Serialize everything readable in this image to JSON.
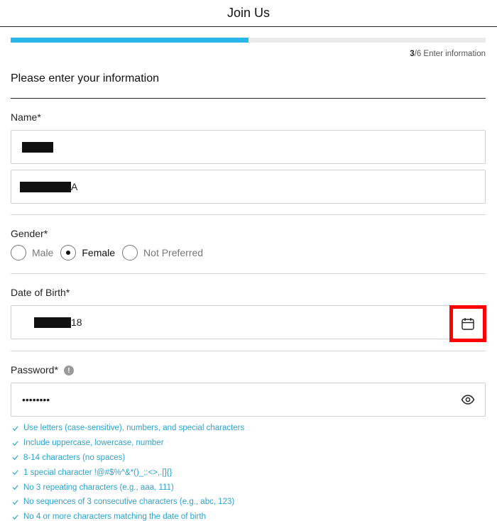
{
  "header": {
    "title": "Join Us"
  },
  "progress": {
    "current_step": "3",
    "total_label": "/6",
    "caption": "Enter information",
    "fraction": 0.5
  },
  "section": {
    "title": "Please enter your information"
  },
  "name": {
    "label": "Name*",
    "first_value_visible": "",
    "last_value_visible": "A"
  },
  "gender": {
    "label": "Gender*",
    "options": [
      {
        "label": "Male",
        "selected": false
      },
      {
        "label": "Female",
        "selected": true
      },
      {
        "label": "Not Preferred",
        "selected": false
      }
    ]
  },
  "dob": {
    "label": "Date of Birth*",
    "value_visible": "18"
  },
  "password": {
    "label": "Password*",
    "info_glyph": "!",
    "value": "••••••••",
    "rules": [
      "Use letters (case-sensitive), numbers, and special characters",
      "Include uppercase, lowercase, number",
      "8-14 characters (no spaces)",
      "1 special character !@#$%^&*()_;:<>,.[]{}",
      "No 3 repeating characters (e.g., aaa, 111)",
      "No sequences of 3 consecutive characters (e.g., abc, 123)",
      "No 4 or more characters matching the date of birth"
    ]
  },
  "colors": {
    "accent": "#29b6e8",
    "highlight": "#ff0000",
    "rule_text": "#2aa3cc"
  },
  "icons": {
    "calendar": "calendar-icon",
    "eye": "eye-icon",
    "info": "info-icon",
    "check": "check-icon"
  }
}
